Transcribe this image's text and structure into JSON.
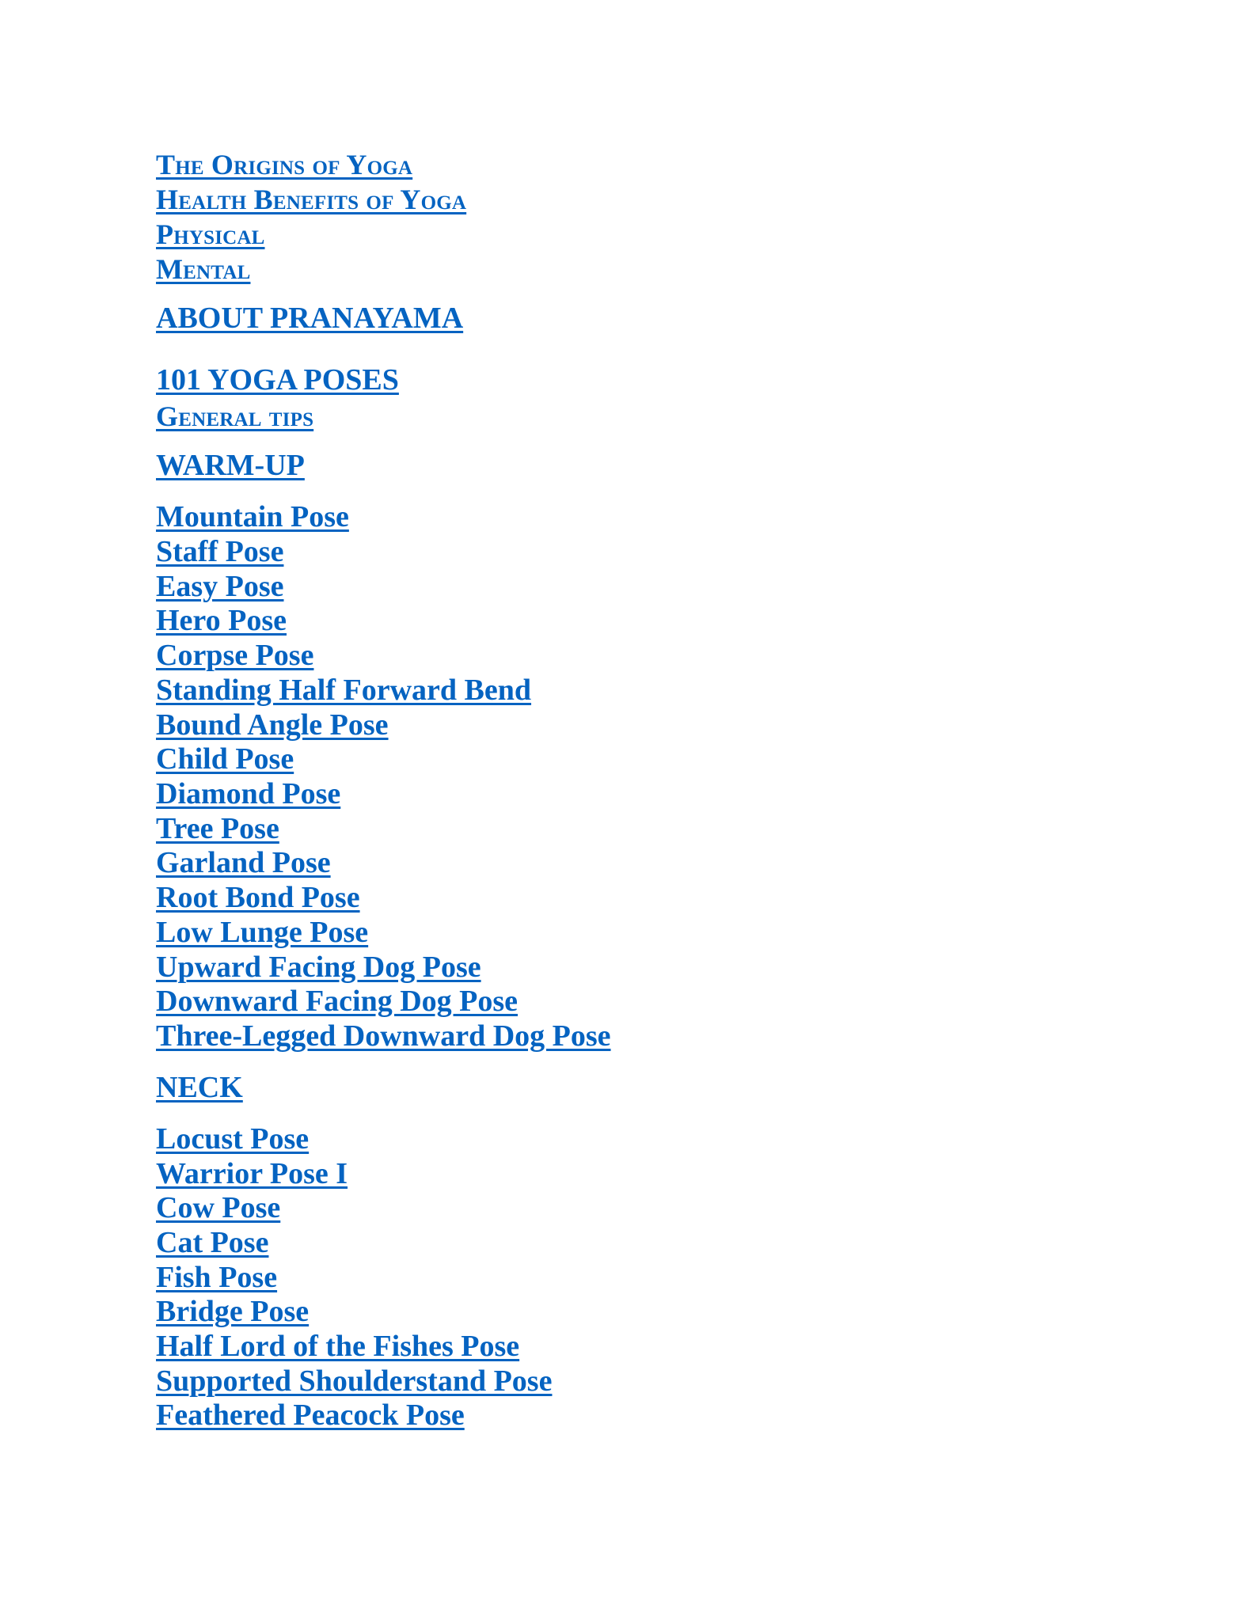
{
  "toc": {
    "intro": [
      {
        "label": "The Origins of Yoga"
      },
      {
        "label": "Health Benefits of Yoga"
      },
      {
        "label": "Physical"
      },
      {
        "label": "Mental"
      }
    ],
    "about_pranayama": "ABOUT PRANAYAMA",
    "yoga_poses_heading": "101 YOGA POSES",
    "general_tips": "General tips",
    "warm_up": {
      "heading": "WARM-UP",
      "items": [
        "Mountain Pose",
        "Staff Pose",
        "Easy Pose",
        "Hero Pose",
        "Corpse Pose",
        "Standing Half Forward Bend",
        "Bound Angle Pose",
        "Child Pose",
        "Diamond Pose",
        "Tree Pose",
        "Garland Pose",
        "Root Bond Pose",
        "Low Lunge Pose",
        "Upward Facing Dog Pose",
        "Downward Facing Dog Pose",
        "Three-Legged Downward Dog Pose"
      ]
    },
    "neck": {
      "heading": "NECK",
      "items": [
        "Locust Pose",
        "Warrior Pose I",
        "Cow Pose",
        "Cat Pose",
        "Fish Pose",
        "Bridge Pose",
        "Half Lord of the Fishes Pose",
        "Supported Shoulderstand Pose",
        "Feathered Peacock Pose"
      ]
    }
  },
  "colors": {
    "link": "#0563C1",
    "background": "#FFFFFF"
  }
}
